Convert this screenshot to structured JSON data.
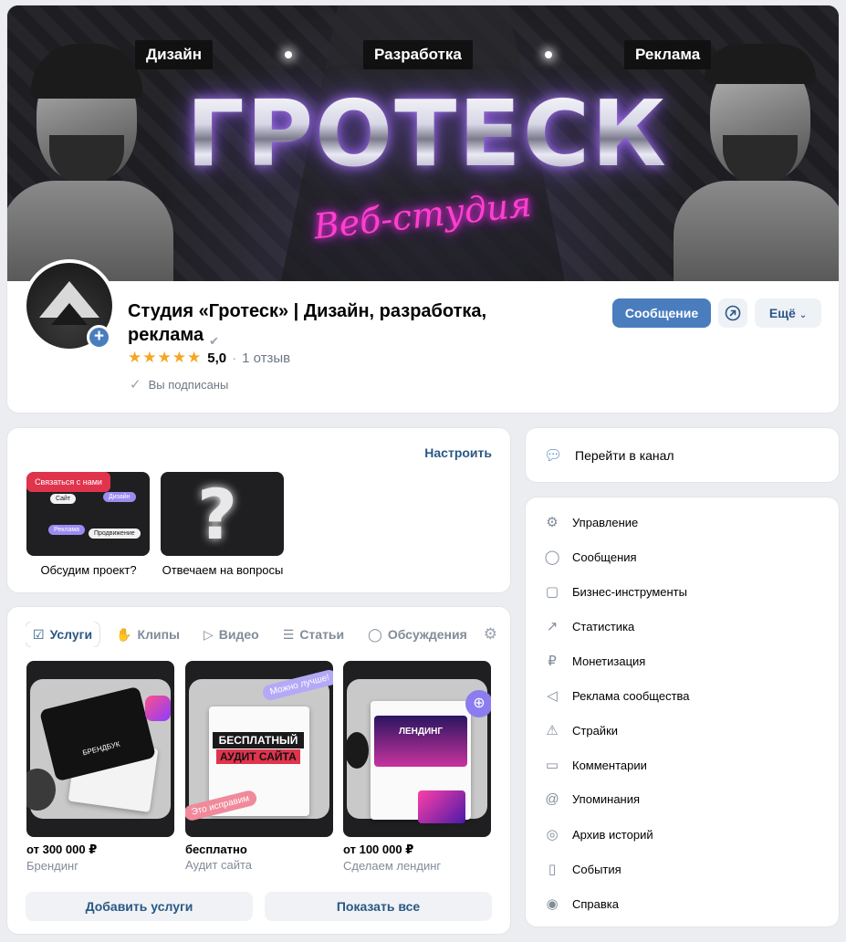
{
  "cover": {
    "menu": [
      "Дизайн",
      "Разработка",
      "Реклама"
    ],
    "title": "ГРОТЕСК",
    "subtitle": "Веб-студия"
  },
  "profile": {
    "name": "Студия «Гротеск» | Дизайн, разработка, реклама",
    "rating": "5,0",
    "reviews": "1 отзыв",
    "subscribed": "Вы подписаны",
    "buttons": {
      "message": "Сообщение",
      "more": "Ещё"
    }
  },
  "links": {
    "config": "Настроить",
    "items": [
      {
        "label": "Обсудим проект?",
        "pills": [
          "Сайт",
          "Дизайн",
          "Связаться с нами",
          "Реклама",
          "Продвижение"
        ]
      },
      {
        "label": "Отвечаем на вопросы"
      }
    ]
  },
  "services": {
    "tabs": [
      "Услуги",
      "Клипы",
      "Видео",
      "Статьи",
      "Обсуждения"
    ],
    "items": [
      {
        "price": "от 300 000 ₽",
        "name": "Брендинг",
        "img_text": "БРЕНДБУК"
      },
      {
        "price": "бесплатно",
        "name": "Аудит сайта",
        "img_text": [
          "БЕСПЛАТНЫЙ",
          "АУДИТ САЙТА"
        ],
        "tags": [
          "Можно лучше!",
          "Это исправим"
        ]
      },
      {
        "price": "от 100 000 ₽",
        "name": "Сделаем лендинг",
        "img_text": "ЛЕНДИНГ"
      }
    ],
    "add_button": "Добавить услуги",
    "show_all_button": "Показать все"
  },
  "channel": {
    "label": "Перейти в канал"
  },
  "menu": [
    {
      "label": "Управление",
      "icon": "gear-icon"
    },
    {
      "label": "Сообщения",
      "icon": "message-icon"
    },
    {
      "label": "Бизнес-инструменты",
      "icon": "briefcase-icon"
    },
    {
      "label": "Статистика",
      "icon": "chart-icon"
    },
    {
      "label": "Монетизация",
      "icon": "ruble-icon"
    },
    {
      "label": "Реклама сообщества",
      "icon": "megaphone-icon"
    },
    {
      "label": "Страйки",
      "icon": "warning-icon"
    },
    {
      "label": "Комментарии",
      "icon": "comment-icon"
    },
    {
      "label": "Упоминания",
      "icon": "at-icon"
    },
    {
      "label": "Архив историй",
      "icon": "story-icon"
    },
    {
      "label": "События",
      "icon": "calendar-icon"
    },
    {
      "label": "Справка",
      "icon": "help-icon"
    }
  ],
  "colors": {
    "accent": "#4a7dbe",
    "link": "#2a5885",
    "star": "#f5a623",
    "background": "#ebedf0"
  }
}
